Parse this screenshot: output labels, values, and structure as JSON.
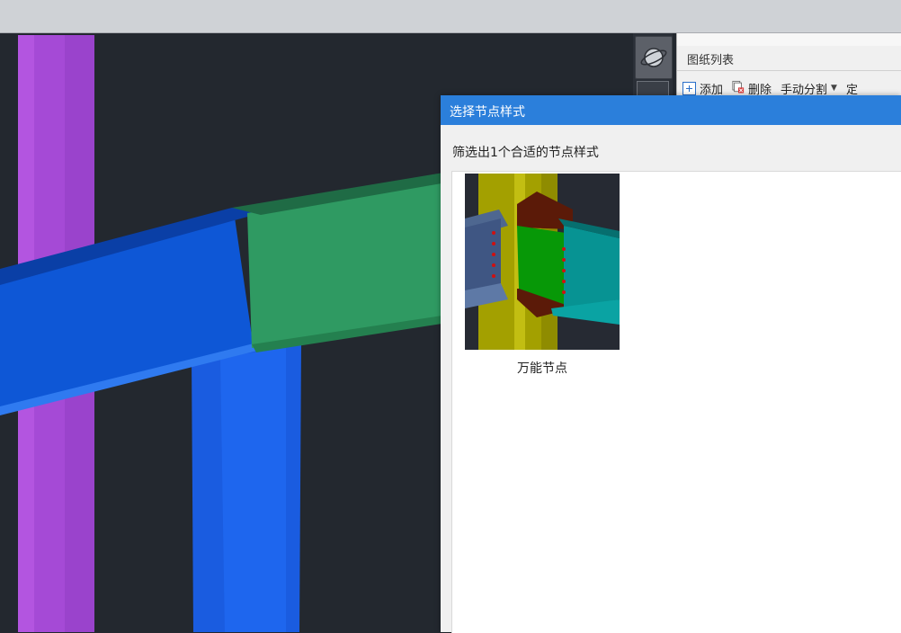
{
  "viewport": {
    "orbit_icon": "orbit-icon",
    "colors": {
      "background": "#23282f",
      "purple_column": "#a54ad6",
      "blue_beam": "#0e57d6",
      "green_beam": "#2f9a62",
      "blue_column": "#1a5ce0"
    }
  },
  "drawing_panel": {
    "title": "图纸列表",
    "toolbar": {
      "add_label": "添加",
      "delete_label": "删除",
      "manual_split_label": "手动分割",
      "more_label": "定"
    }
  },
  "dialog": {
    "title": "选择节点样式",
    "filter_text": "筛选出1个合适的节点样式",
    "nodes": [
      {
        "label": "万能节点"
      }
    ]
  }
}
